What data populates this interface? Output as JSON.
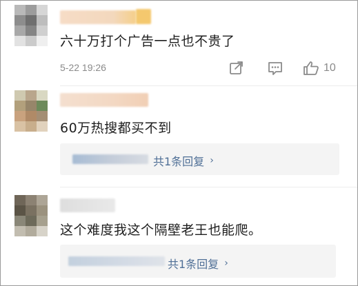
{
  "comments": [
    {
      "text": "六十万打个广告一点也不贵了",
      "timestamp": "5-22 19:26",
      "like_count": "10",
      "share_icon": "share-icon",
      "comment_icon": "comment-icon",
      "like_icon": "like-icon"
    },
    {
      "text": "60万热搜都买不到",
      "reply_label": "共1条回复",
      "chevron": "›"
    },
    {
      "text": "这个难度我这个隔壁老王也能爬。",
      "reply_label": "共1条回复",
      "chevron": "›"
    }
  ],
  "colors": {
    "link": "#4f6f96",
    "meta": "#8a8a8a",
    "reply_bg": "#f4f4f4"
  }
}
